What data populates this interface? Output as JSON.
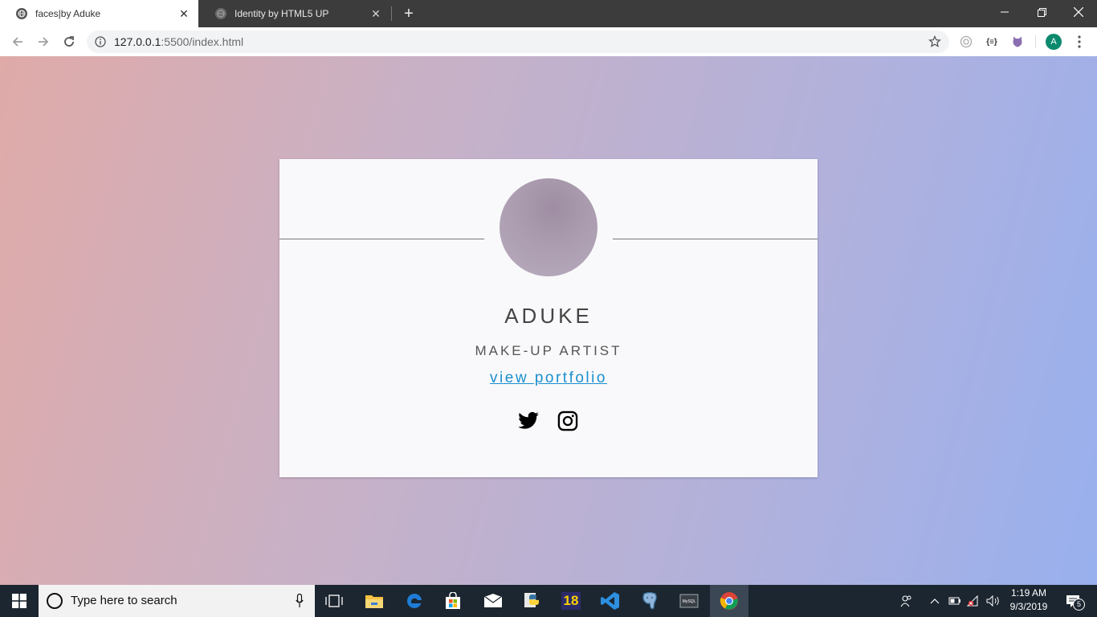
{
  "browser": {
    "tabs": [
      {
        "title": "faces|by Aduke",
        "active": true
      },
      {
        "title": "Identity by HTML5 UP",
        "active": false
      }
    ],
    "url_host": "127.0.0.1",
    "url_path": ":5500/index.html",
    "profile_initial": "A"
  },
  "profile": {
    "name": "ADUKE",
    "role": "MAKE-UP ARTIST",
    "portfolio_link": "view portfolio",
    "social": [
      "twitter-icon",
      "instagram-icon"
    ]
  },
  "taskbar": {
    "search_placeholder": "Type here to search",
    "pinned": [
      "task-view-icon",
      "file-explorer-icon",
      "edge-icon",
      "store-icon",
      "mail-icon",
      "python-icon",
      "app-18-icon",
      "vscode-icon",
      "postgresql-icon",
      "mysql-icon",
      "chrome-icon"
    ],
    "badge_18": "18",
    "clock_time": "1:19 AM",
    "clock_date": "9/3/2019",
    "notification_count": "5"
  },
  "colors": {
    "gradient_left": "#dfaaa8",
    "gradient_right": "#98b0ee",
    "link": "#1a8fd0",
    "card": "#f9f9fb"
  }
}
